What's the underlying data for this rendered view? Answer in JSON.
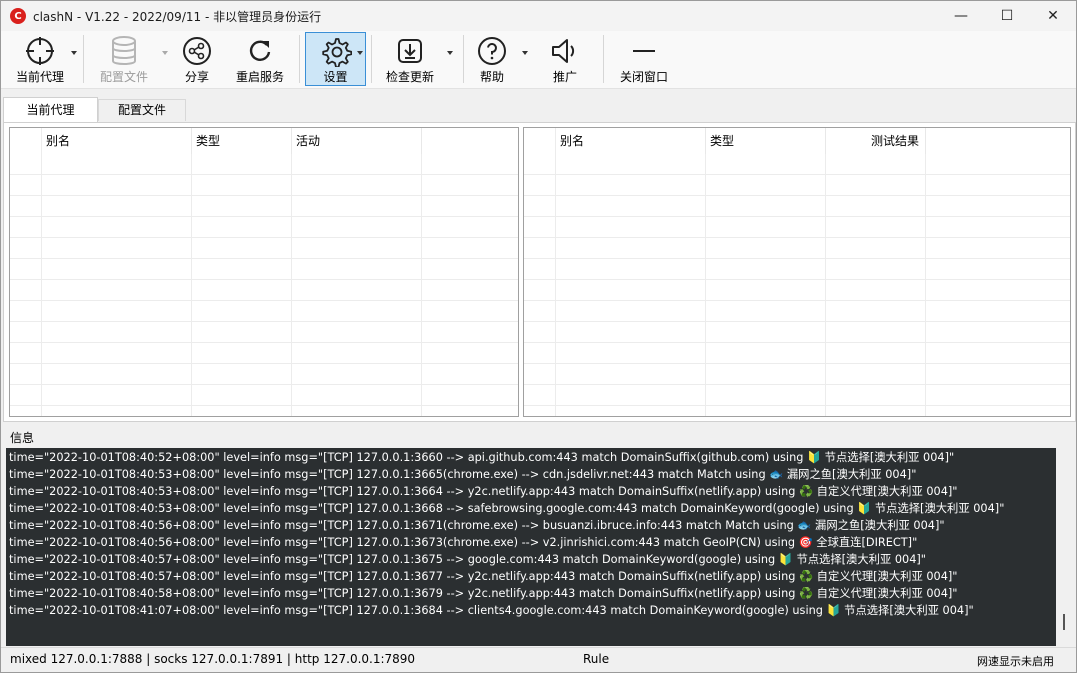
{
  "window": {
    "title": "clashN - V1.22 - 2022/09/11 - 非以管理员身份运行",
    "logo_letter": "C",
    "minimize": "—",
    "maximize": "☐",
    "close": "✕"
  },
  "toolbar": {
    "current_proxy": "当前代理",
    "config_file": "配置文件",
    "share": "分享",
    "restart_service": "重启服务",
    "settings": "设置",
    "check_update": "检查更新",
    "help": "帮助",
    "promote": "推广",
    "close_window": "关闭窗口"
  },
  "tabs": {
    "current_proxy": "当前代理",
    "config_file": "配置文件"
  },
  "left_grid": {
    "columns": [
      "别名",
      "类型",
      "活动"
    ]
  },
  "right_grid": {
    "columns": [
      "别名",
      "类型",
      "测试结果"
    ]
  },
  "info": {
    "label": "信息",
    "lines": [
      "time=\"2022-10-01T08:40:52+08:00\" level=info msg=\"[TCP] 127.0.0.1:3660 --> api.github.com:443 match DomainSuffix(github.com) using 🔰 节点选择[澳大利亚 004]\"",
      "time=\"2022-10-01T08:40:53+08:00\" level=info msg=\"[TCP] 127.0.0.1:3665(chrome.exe) --> cdn.jsdelivr.net:443 match Match using 🐟 漏网之鱼[澳大利亚 004]\"",
      "time=\"2022-10-01T08:40:53+08:00\" level=info msg=\"[TCP] 127.0.0.1:3664 --> y2c.netlify.app:443 match DomainSuffix(netlify.app) using ♻️ 自定义代理[澳大利亚 004]\"",
      "time=\"2022-10-01T08:40:53+08:00\" level=info msg=\"[TCP] 127.0.0.1:3668 --> safebrowsing.google.com:443 match DomainKeyword(google) using 🔰 节点选择[澳大利亚 004]\"",
      "time=\"2022-10-01T08:40:56+08:00\" level=info msg=\"[TCP] 127.0.0.1:3671(chrome.exe) --> busuanzi.ibruce.info:443 match Match using 🐟 漏网之鱼[澳大利亚 004]\"",
      "time=\"2022-10-01T08:40:56+08:00\" level=info msg=\"[TCP] 127.0.0.1:3673(chrome.exe) --> v2.jinrishici.com:443 match GeoIP(CN) using 🎯 全球直连[DIRECT]\"",
      "time=\"2022-10-01T08:40:57+08:00\" level=info msg=\"[TCP] 127.0.0.1:3675 --> google.com:443 match DomainKeyword(google) using 🔰 节点选择[澳大利亚 004]\"",
      "time=\"2022-10-01T08:40:57+08:00\" level=info msg=\"[TCP] 127.0.0.1:3677 --> y2c.netlify.app:443 match DomainSuffix(netlify.app) using ♻️ 自定义代理[澳大利亚 004]\"",
      "time=\"2022-10-01T08:40:58+08:00\" level=info msg=\"[TCP] 127.0.0.1:3679 --> y2c.netlify.app:443 match DomainSuffix(netlify.app) using ♻️ 自定义代理[澳大利亚 004]\"",
      "time=\"2022-10-01T08:41:07+08:00\" level=info msg=\"[TCP] 127.0.0.1:3684 --> clients4.google.com:443 match DomainKeyword(google) using 🔰 节点选择[澳大利亚 004]\""
    ]
  },
  "status": {
    "ports": "mixed 127.0.0.1:7888 | socks 127.0.0.1:7891 | http 127.0.0.1:7890",
    "mode": "Rule",
    "speed": "网速显示未启用"
  }
}
